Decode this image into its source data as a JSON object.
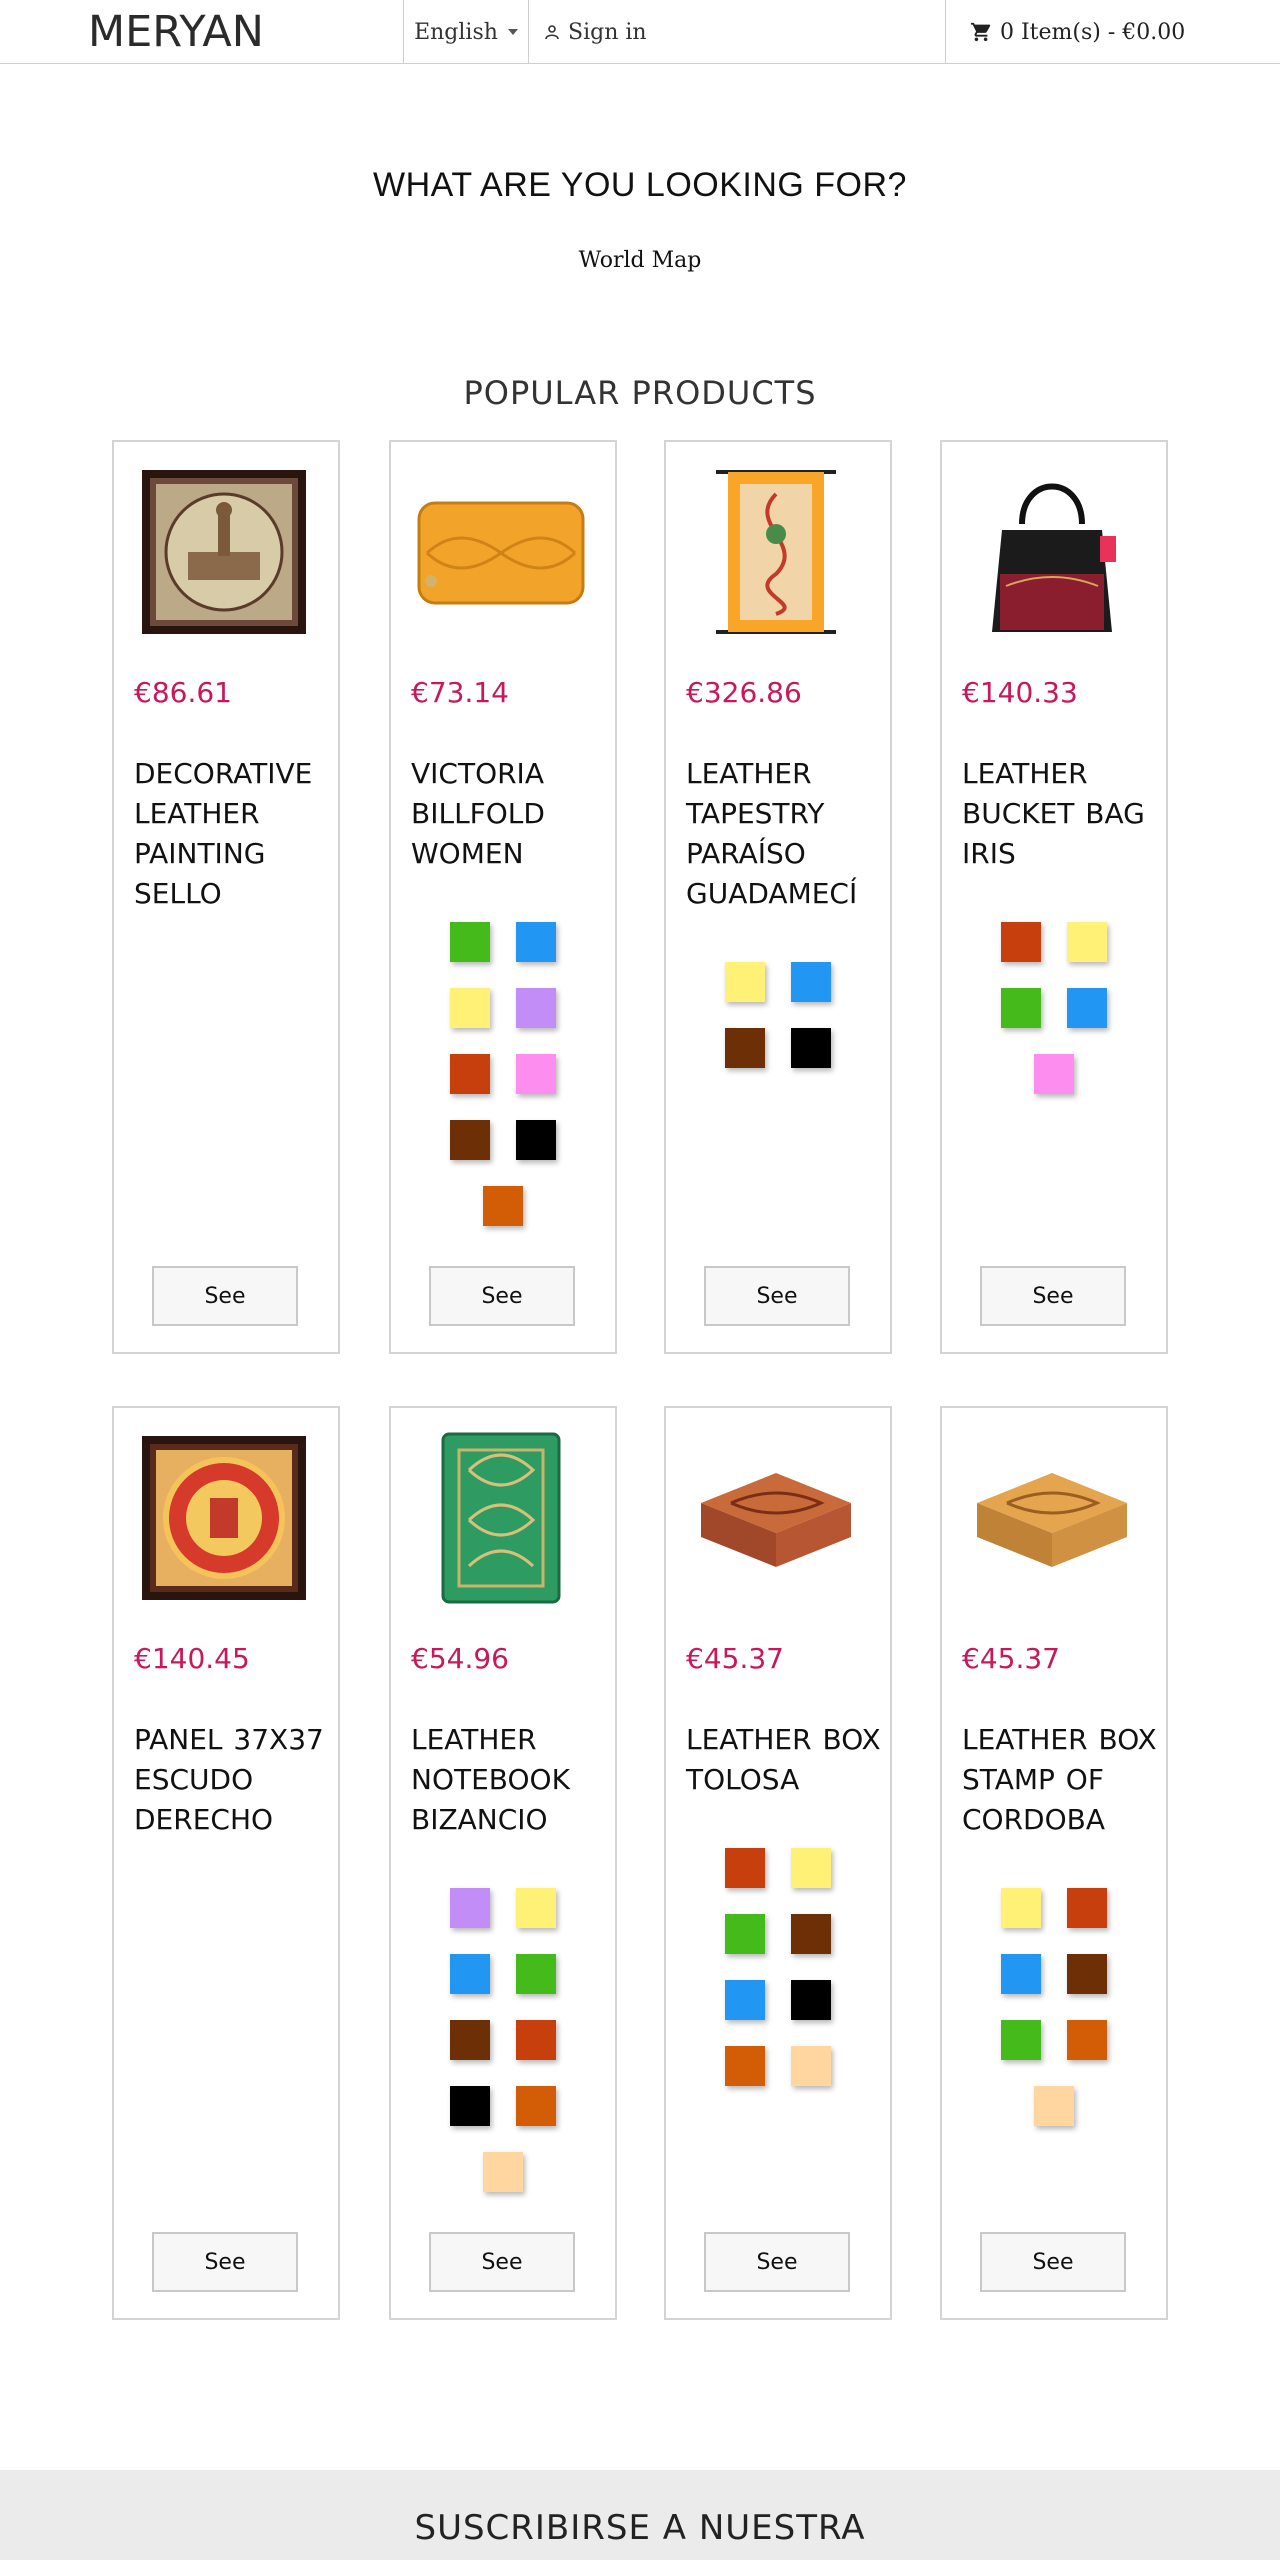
{
  "header": {
    "logo": "MERYAN",
    "language": "English",
    "signin": "Sign in",
    "cart": "0 Item(s) - €0.00"
  },
  "search": {
    "title": "WHAT ARE YOU LOOKING FOR?",
    "link": "World Map"
  },
  "popular_title": "POPULAR PRODUCTS",
  "see_label": "See",
  "colors": {
    "price": "#c8185c",
    "green": "#44bb1a",
    "blue": "#2196f3",
    "yellow": "#fff176",
    "lilac": "#c38df7",
    "rust": "#c63f0c",
    "pink": "#fd8ef0",
    "brown": "#6d3006",
    "black": "#000000",
    "orange": "#d35c07",
    "peach": "#ffd6a0"
  },
  "products": [
    {
      "price": "€86.61",
      "name": "DECORATIVE LEATHER PAINTING SELLO",
      "image": "decorative-painting-image",
      "swatches": []
    },
    {
      "price": "€73.14",
      "name": "VICTORIA BILLFOLD WOMEN",
      "image": "wallet-image",
      "swatches": [
        "green",
        "blue",
        "yellow",
        "lilac",
        "rust",
        "pink",
        "brown",
        "black",
        "orange"
      ]
    },
    {
      "price": "€326.86",
      "name": "LEATHER TAPESTRY PARAÍSO GUADAMECÍ",
      "image": "tapestry-image",
      "swatches": [
        "yellow",
        "blue",
        "brown",
        "black"
      ]
    },
    {
      "price": "€140.33",
      "name": "LEATHER BUCKET BAG IRIS",
      "image": "bucket-bag-image",
      "swatches": [
        "rust",
        "yellow",
        "green",
        "blue",
        "pink"
      ]
    },
    {
      "price": "€140.45",
      "name": "PANEL 37X37 ESCUDO DERECHO",
      "image": "panel-escudo-image",
      "swatches": []
    },
    {
      "price": "€54.96",
      "name": "LEATHER NOTEBOOK BIZANCIO",
      "image": "notebook-image",
      "swatches": [
        "lilac",
        "yellow",
        "blue",
        "green",
        "brown",
        "rust",
        "black",
        "orange",
        "peach"
      ]
    },
    {
      "price": "€45.37",
      "name": "LEATHER BOX TOLOSA",
      "image": "box-tolosa-image",
      "swatches": [
        "rust",
        "yellow",
        "green",
        "brown",
        "blue",
        "black",
        "orange",
        "peach"
      ]
    },
    {
      "price": "€45.37",
      "name": "LEATHER BOX STAMP OF CORDOBA",
      "image": "box-cordoba-image",
      "swatches": [
        "yellow",
        "rust",
        "blue",
        "brown",
        "green",
        "orange",
        "peach"
      ]
    }
  ],
  "newsletter": {
    "title": "SUSCRIBIRSE A NUESTRA"
  }
}
